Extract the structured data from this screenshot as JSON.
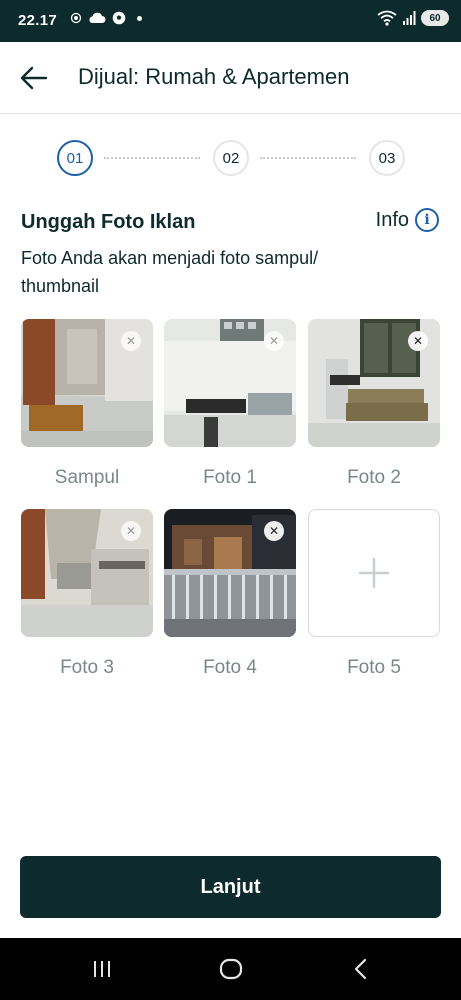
{
  "status_bar": {
    "time": "22.17",
    "battery": "60",
    "icons": [
      "screen-recorder-icon",
      "cloud-icon",
      "soccer-ball-icon",
      "notification-dot-icon",
      "wifi-icon",
      "signal-icon",
      "battery-icon"
    ]
  },
  "app_bar": {
    "back_icon": "arrow-left-icon",
    "title": "Dijual: Rumah & Apartemen"
  },
  "stepper": {
    "steps": [
      {
        "label": "01",
        "active": true
      },
      {
        "label": "02",
        "active": false
      },
      {
        "label": "03",
        "active": false
      }
    ]
  },
  "section": {
    "title": "Unggah Foto Iklan",
    "info_label": "Info",
    "info_icon": "info-circle-icon",
    "description": "Foto Anda akan menjadi foto sampul/ thumbnail"
  },
  "photos": [
    {
      "caption": "Sampul",
      "remove_icon": "close-icon"
    },
    {
      "caption": "Foto 1",
      "remove_icon": "close-icon"
    },
    {
      "caption": "Foto 2",
      "remove_icon": "close-icon"
    },
    {
      "caption": "Foto 3",
      "remove_icon": "close-icon"
    },
    {
      "caption": "Foto 4",
      "remove_icon": "close-icon"
    }
  ],
  "add_photo": {
    "caption": "Foto 5",
    "icon": "plus-icon"
  },
  "continue_label": "Lanjut",
  "nav_bar": {
    "icons": [
      "recent-apps-icon",
      "home-icon",
      "back-icon"
    ]
  },
  "colors": {
    "primary": "#0d2a2c",
    "accent": "#1e5fa8",
    "caption": "#7c8787",
    "border": "#e4e6e6"
  }
}
